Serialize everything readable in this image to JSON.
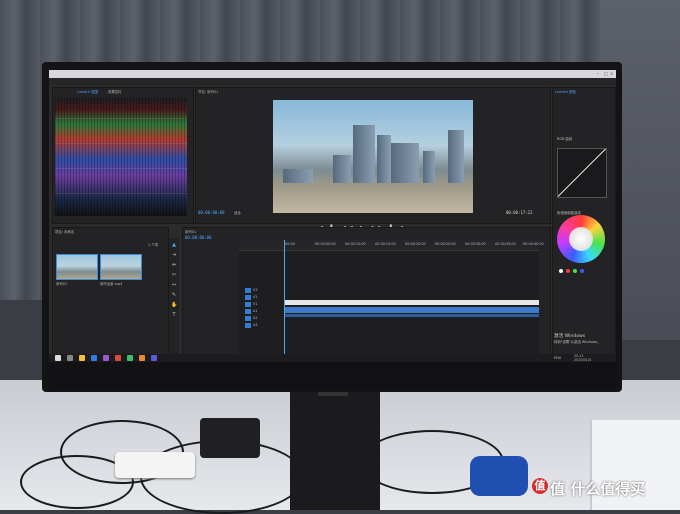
{
  "screen": {
    "workspace_tab": "编辑",
    "scopes_panel": {
      "tab_label": "Lumetri 范围",
      "tab_label_2": "效果控件"
    },
    "program_monitor": {
      "title": "节目: 序列01",
      "timecode_left": "00:00:00:00",
      "timecode_right": "00:00:17:22",
      "fit_label": "适合"
    },
    "project_panel": {
      "title": "项目: 未命名",
      "item_1": "序列01",
      "item_2": "城市全景.mp4",
      "count": "1 个项"
    },
    "timeline": {
      "title": "序列01",
      "timecode": "00:00:00:00",
      "ruler_ticks": [
        "00:00",
        "00:00:05:00",
        "00:00:10:00",
        "00:00:15:00",
        "00:00:20:00",
        "00:00:25:00",
        "00:00:30:00",
        "00:00:35:00",
        "00:00:40:00"
      ],
      "track_labels": [
        "V3",
        "V2",
        "V1",
        "A1",
        "A2",
        "A3"
      ]
    },
    "lumetri_color": {
      "title": "Lumetri 颜色",
      "curves_label": "RGB 曲线",
      "hue_label": "色相饱和度曲线"
    },
    "activation": {
      "title": "激活 Windows",
      "subtitle": "转到\"设置\"以激活 Windows。"
    },
    "taskbar": {
      "time": "20:11",
      "date": "2020/3/15",
      "lang": "ENG"
    }
  },
  "watermark": {
    "text": "值 什么值得买",
    "icon": "zhi-logo-icon"
  },
  "colors": {
    "premiere_blue": "#4fa6ff",
    "panel_bg": "#232325",
    "watermark_red": "#d82b2b"
  }
}
